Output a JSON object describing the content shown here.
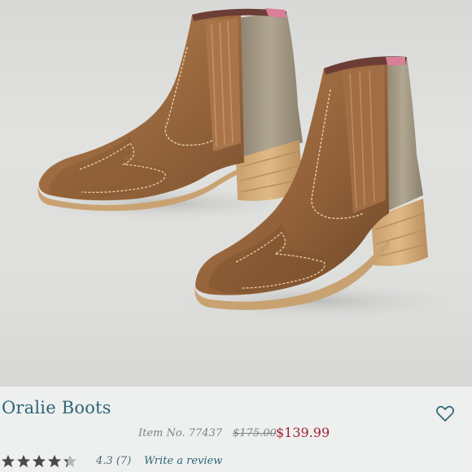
{
  "product": {
    "name": "Oralie Boots",
    "item_number": "Item No. 77437",
    "original_price": "$175.00",
    "sale_price": "$139.99",
    "rating_value": "4.3",
    "review_count": "(7)",
    "review_link": "Write a review",
    "star_rating": 4.3,
    "max_stars": 5
  },
  "icons": {
    "wishlist": "heart-outline-icon",
    "rating": "star-icon"
  },
  "colors": {
    "title": "#2f6478",
    "sale_price": "#a41f34",
    "muted_text": "#7c8386",
    "star_filled": "#4a4a4a",
    "star_empty": "#b5b8b8",
    "panel": "#eef0ef"
  }
}
